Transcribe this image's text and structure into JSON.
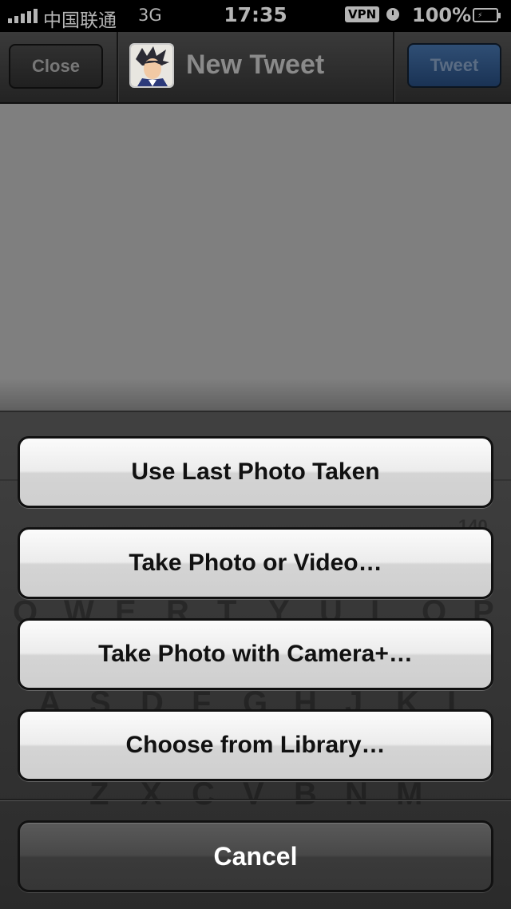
{
  "status_bar": {
    "carrier": "中国联通",
    "network": "3G",
    "time": "17:35",
    "vpn": "VPN",
    "battery_percent": "100%"
  },
  "nav": {
    "close_label": "Close",
    "title": "New Tweet",
    "tweet_label": "Tweet"
  },
  "background_keyboard": {
    "row1": [
      "Q",
      "W",
      "E",
      "R",
      "T",
      "Y",
      "U",
      "I",
      "O",
      "P"
    ],
    "row2": [
      "A",
      "S",
      "D",
      "F",
      "G",
      "H",
      "J",
      "K",
      "L"
    ],
    "row3": [
      "Z",
      "X",
      "C",
      "V",
      "B",
      "N",
      "M"
    ],
    "char_count": "140"
  },
  "action_sheet": {
    "options": [
      {
        "label": "Use Last Photo Taken"
      },
      {
        "label": "Take Photo or Video…"
      },
      {
        "label": "Take Photo with Camera+…"
      },
      {
        "label": "Choose from Library…"
      }
    ],
    "cancel_label": "Cancel"
  },
  "colors": {
    "tweet_button": "#1a3355",
    "sheet_background": "#3d3d3d",
    "compose_dim": "#7f7f7f"
  }
}
